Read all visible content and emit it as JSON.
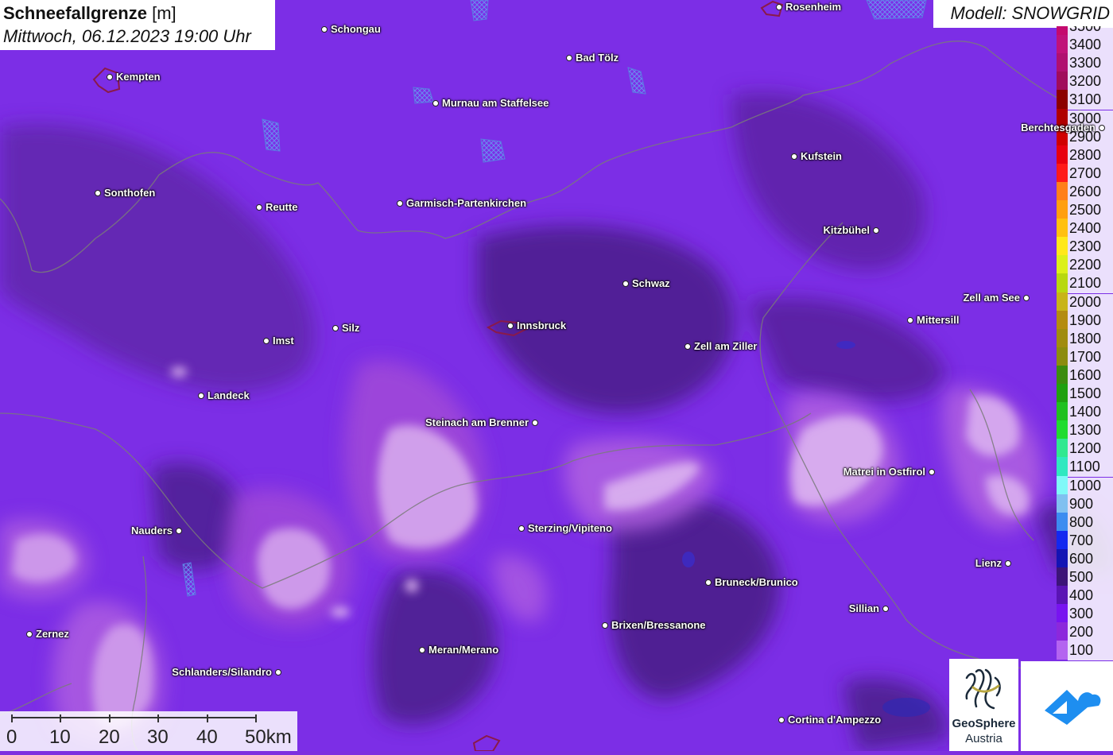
{
  "header": {
    "title_main": "Schneefallgrenze",
    "title_unit": "[m]",
    "datetime": "Mittwoch, 06.12.2023 19:00 Uhr",
    "model": "Modell: SNOWGRID"
  },
  "legend": {
    "levels": [
      {
        "value": "3500",
        "color": "#c40a6e"
      },
      {
        "value": "3400",
        "color": "#c0127a"
      },
      {
        "value": "3300",
        "color": "#b01070"
      },
      {
        "value": "3200",
        "color": "#a00c5c"
      },
      {
        "value": "3100",
        "color": "#8c0000"
      },
      {
        "value": "3000",
        "color": "#b00000"
      },
      {
        "value": "2900",
        "color": "#d00000"
      },
      {
        "value": "2800",
        "color": "#e80010"
      },
      {
        "value": "2700",
        "color": "#ff1a1a"
      },
      {
        "value": "2600",
        "color": "#ff7f1a"
      },
      {
        "value": "2500",
        "color": "#ff9f10"
      },
      {
        "value": "2400",
        "color": "#ffc010"
      },
      {
        "value": "2300",
        "color": "#ffe81a"
      },
      {
        "value": "2200",
        "color": "#dcf01a"
      },
      {
        "value": "2100",
        "color": "#b8d810"
      },
      {
        "value": "2000",
        "color": "#c8b418"
      },
      {
        "value": "1900",
        "color": "#b48c10"
      },
      {
        "value": "1800",
        "color": "#a08c10"
      },
      {
        "value": "1700",
        "color": "#8c8c10"
      },
      {
        "value": "1600",
        "color": "#3c8c10"
      },
      {
        "value": "1500",
        "color": "#20a010"
      },
      {
        "value": "1400",
        "color": "#20c020"
      },
      {
        "value": "1300",
        "color": "#20dc30"
      },
      {
        "value": "1200",
        "color": "#30e890"
      },
      {
        "value": "1100",
        "color": "#30e8c0"
      },
      {
        "value": "1000",
        "color": "#80f8f8"
      },
      {
        "value": "900",
        "color": "#80c0f0"
      },
      {
        "value": "800",
        "color": "#3c8cf0"
      },
      {
        "value": "700",
        "color": "#1428f0"
      },
      {
        "value": "600",
        "color": "#1414b4"
      },
      {
        "value": "500",
        "color": "#3c1478"
      },
      {
        "value": "400",
        "color": "#5a14b4"
      },
      {
        "value": "300",
        "color": "#7814f0"
      },
      {
        "value": "200",
        "color": "#8c28dc"
      },
      {
        "value": "100",
        "color": "#b464f0"
      }
    ]
  },
  "cities": [
    {
      "name": "Rosenheim"
    },
    {
      "name": "Schongau"
    },
    {
      "name": "Bad Tölz"
    },
    {
      "name": "Kempten"
    },
    {
      "name": "Murnau am Staffelsee"
    },
    {
      "name": "Berchtesgaden"
    },
    {
      "name": "Kufstein"
    },
    {
      "name": "Sonthofen"
    },
    {
      "name": "Reutte"
    },
    {
      "name": "Garmisch-Partenkirchen"
    },
    {
      "name": "Kitzbühel"
    },
    {
      "name": "Schwaz"
    },
    {
      "name": "Zell am See"
    },
    {
      "name": "Mittersill"
    },
    {
      "name": "Innsbruck"
    },
    {
      "name": "Imst"
    },
    {
      "name": "Silz"
    },
    {
      "name": "Zell am Ziller"
    },
    {
      "name": "Landeck"
    },
    {
      "name": "Steinach am Brenner"
    },
    {
      "name": "Matrei in Ostfirol"
    },
    {
      "name": "Nauders"
    },
    {
      "name": "Sterzing/Vipiteno"
    },
    {
      "name": "Lienz"
    },
    {
      "name": "Bruneck/Brunico"
    },
    {
      "name": "Sillian"
    },
    {
      "name": "Brixen/Bressanone"
    },
    {
      "name": "Zernez"
    },
    {
      "name": "Meran/Merano"
    },
    {
      "name": "Schlanders/Silandro"
    },
    {
      "name": "Cortina d'Ampezzo"
    }
  ],
  "scale_bar": {
    "labels": [
      "0",
      "10",
      "20",
      "30",
      "40",
      "50km"
    ]
  },
  "logos": {
    "geosphere_line1": "GeoSphere",
    "geosphere_line2": "Austria"
  }
}
